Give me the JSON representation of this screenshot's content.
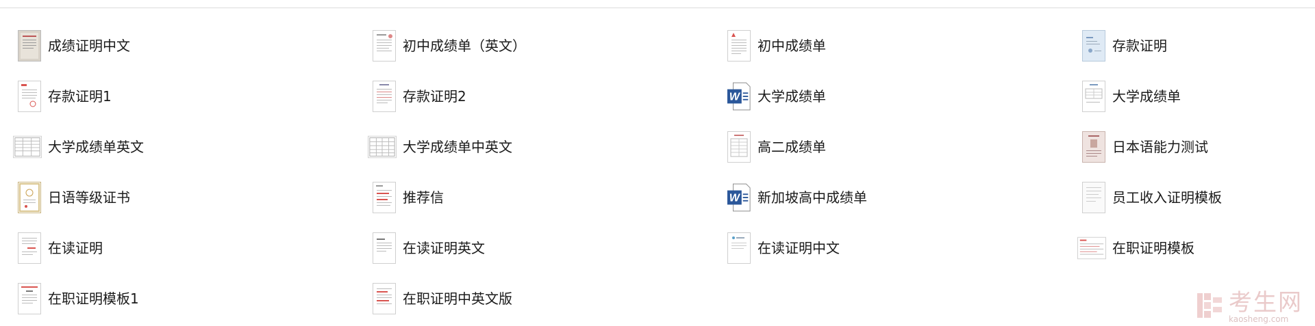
{
  "files": [
    {
      "name": "成绩证明中文",
      "icon": "scanned-document-icon"
    },
    {
      "name": "初中成绩单（英文）",
      "icon": "document-thumbnail-icon"
    },
    {
      "name": "初中成绩单",
      "icon": "document-thumbnail-icon"
    },
    {
      "name": "存款证明",
      "icon": "blue-certificate-thumbnail-icon"
    },
    {
      "name": "存款证明1",
      "icon": "document-thumbnail-icon"
    },
    {
      "name": "存款证明2",
      "icon": "document-thumbnail-icon"
    },
    {
      "name": "大学成绩单",
      "icon": "word-file-icon"
    },
    {
      "name": "大学成绩单",
      "icon": "document-thumbnail-icon"
    },
    {
      "name": "大学成绩单英文",
      "icon": "landscape-table-thumbnail-icon"
    },
    {
      "name": "大学成绩单中英文",
      "icon": "landscape-table-thumbnail-icon"
    },
    {
      "name": "高二成绩单",
      "icon": "document-thumbnail-icon"
    },
    {
      "name": "日本语能力测试",
      "icon": "certificate-thumbnail-icon"
    },
    {
      "name": "日语等级证书",
      "icon": "gold-certificate-thumbnail-icon"
    },
    {
      "name": "推荐信",
      "icon": "document-thumbnail-icon"
    },
    {
      "name": "新加坡高中成绩单",
      "icon": "word-file-icon"
    },
    {
      "name": "员工收入证明模板",
      "icon": "document-thumbnail-icon"
    },
    {
      "name": "在读证明",
      "icon": "document-thumbnail-icon"
    },
    {
      "name": "在读证明英文",
      "icon": "document-thumbnail-icon"
    },
    {
      "name": "在读证明中文",
      "icon": "document-thumbnail-icon"
    },
    {
      "name": "在职证明模板",
      "icon": "landscape-table-thumbnail-icon"
    },
    {
      "name": "在职证明模板1",
      "icon": "document-thumbnail-icon"
    },
    {
      "name": "在职证明中英文版",
      "icon": "document-thumbnail-icon"
    }
  ],
  "watermark": {
    "name": "考生网",
    "url": "kaosheng.com",
    "icon": "kaosheng-logo-icon"
  },
  "colors": {
    "word_blue": "#2b579a",
    "doc_border": "#cfcfcf",
    "red_accent": "#d9534f"
  }
}
